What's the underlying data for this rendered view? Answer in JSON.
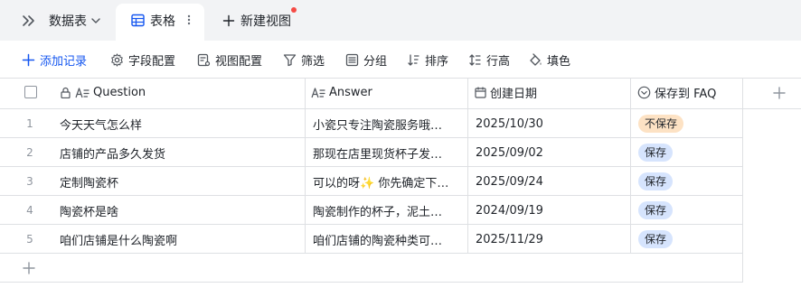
{
  "tabbar": {
    "dataset_label": "数据表",
    "active_tab_label": "表格",
    "new_view_label": "新建视图",
    "new_view_dot_color": "#f54a45"
  },
  "toolbar": {
    "add_record": "添加记录",
    "field_config": "字段配置",
    "view_config": "视图配置",
    "filter": "筛选",
    "group": "分组",
    "sort": "排序",
    "row_height": "行高",
    "fill_color": "填色",
    "accent_color": "#1456f0"
  },
  "columns": {
    "question": "Question",
    "answer": "Answer",
    "created_date": "创建日期",
    "save_faq": "保存到 FAQ"
  },
  "rows": [
    {
      "index": "1",
      "question": "今天天气怎么样",
      "answer": "小瓷只专注陶瓷服务哦…",
      "date": "2025/10/30",
      "faq": "不保存",
      "faq_color": "#fde2c4"
    },
    {
      "index": "2",
      "question": "店铺的产品多久发货",
      "answer": "那现在店里现货杯子发…",
      "date": "2025/09/02",
      "faq": "保存",
      "faq_color": "#d6e4fd"
    },
    {
      "index": "3",
      "question": "定制陶瓷杯",
      "answer": "可以的呀✨ 你先确定下…",
      "date": "2025/09/24",
      "faq": "保存",
      "faq_color": "#d6e4fd"
    },
    {
      "index": "4",
      "question": "陶瓷杯是啥",
      "answer": "陶瓷制作的杯子，泥土…",
      "date": "2024/09/19",
      "faq": "保存",
      "faq_color": "#d6e4fd"
    },
    {
      "index": "5",
      "question": "咱们店铺是什么陶瓷啊",
      "answer": "咱们店铺的陶瓷种类可…",
      "date": "2025/11/29",
      "faq": "保存",
      "faq_color": "#d6e4fd"
    }
  ]
}
